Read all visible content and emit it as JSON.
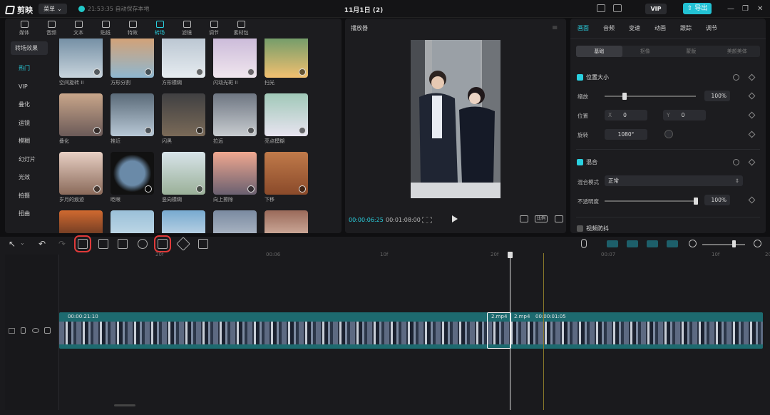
{
  "app": {
    "title": "11月1日 (2)",
    "logo_text": "剪映",
    "menu_label": "菜单",
    "autosave": "21:53:35 自动保存本地",
    "vip_label": "VIP",
    "export_label": "导出"
  },
  "left_tabs": [
    "媒体",
    "音频",
    "文本",
    "贴纸",
    "特效",
    "转场",
    "滤镜",
    "调节",
    "素材包"
  ],
  "left_tabs_active": "转场",
  "left_sidebar": {
    "header": "转场效果",
    "items": [
      "热门",
      "VIP",
      "叠化",
      "运镜",
      "模糊",
      "幻灯片",
      "光效",
      "拍摄",
      "扭曲"
    ],
    "active": "热门"
  },
  "transitions": {
    "row1": [
      "空间旋转 II",
      "方形分割",
      "方形模糊",
      "闪动光斑 II",
      "扫光"
    ],
    "row2": [
      "叠化",
      "推近",
      "闪黑",
      "拉远",
      "亮点模糊"
    ],
    "row3": [
      "岁月的痕迹",
      "眨眼",
      "竖向模糊",
      "向上擦除",
      "下移"
    ],
    "row4": [
      "",
      "",
      "",
      "",
      ""
    ]
  },
  "player": {
    "title": "播放器",
    "current_time": "00:00:06:25",
    "total_time": "00:01:08:00",
    "ratio_label": "比例"
  },
  "right_panel": {
    "tabs": [
      "画面",
      "音频",
      "变速",
      "动画",
      "跟踪",
      "调节"
    ],
    "active_tab": "画面",
    "subtabs": [
      "基础",
      "抠像",
      "蒙版",
      "美颜美体"
    ],
    "active_subtab": "基础",
    "position_size": {
      "title": "位置大小",
      "scale_label": "缩放",
      "scale_value": "100%",
      "scale_fraction": 0.22,
      "position_label": "位置",
      "x_label": "X",
      "x_value": "0",
      "y_label": "Y",
      "y_value": "0",
      "rotation_label": "旋转",
      "rotation_value": "1080°"
    },
    "blend": {
      "title": "混合",
      "mode_label": "混合模式",
      "mode_value": "正常",
      "opacity_label": "不透明度",
      "opacity_value": "100%",
      "opacity_fraction": 1.0
    },
    "stabilize": {
      "title": "视频防抖"
    }
  },
  "timeline": {
    "ruler_ticks": [
      "20f",
      "00:06",
      "10f",
      "20f",
      "00:07",
      "10f",
      "20f"
    ],
    "clip": {
      "label_left": "00:00:21:10",
      "label_a": "2.mp4",
      "label_b": "2.mp4",
      "label_right": "00:00:01:05"
    }
  },
  "colors": {
    "accent": "#2ad1e0",
    "highlight": "#e03a3a",
    "clip": "#1d6a6f"
  }
}
